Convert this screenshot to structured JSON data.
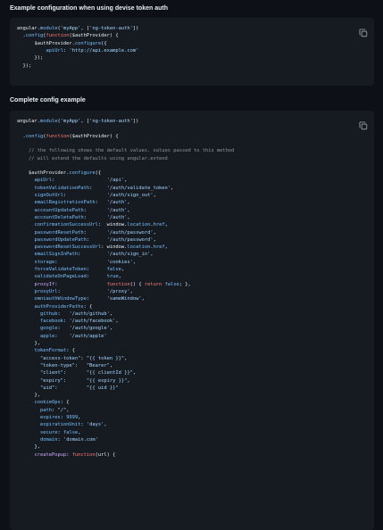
{
  "section1": {
    "heading": "Example configuration when using devise token auth",
    "code": [
      [
        {
          "t": "angular.",
          "c": "v"
        },
        {
          "t": "module",
          "c": "p"
        },
        {
          "t": "(",
          "c": "v"
        },
        {
          "t": "'myApp'",
          "c": "s"
        },
        {
          "t": ", [",
          "c": "v"
        },
        {
          "t": "'ng-token-auth'",
          "c": "s"
        },
        {
          "t": "])",
          "c": "v"
        }
      ],
      [
        {
          "t": "  .",
          "c": "v"
        },
        {
          "t": "config",
          "c": "p"
        },
        {
          "t": "(",
          "c": "v"
        },
        {
          "t": "function",
          "c": "k"
        },
        {
          "t": "($authProvider) {",
          "c": "v"
        }
      ],
      [
        {
          "t": "      $authProvider.",
          "c": "v"
        },
        {
          "t": "configure",
          "c": "p"
        },
        {
          "t": "({",
          "c": "v"
        }
      ],
      [
        {
          "t": "          ",
          "c": "v"
        },
        {
          "t": "apiUrl",
          "c": "p"
        },
        {
          "t": ": ",
          "c": "v"
        },
        {
          "t": "'http://api.example.com'",
          "c": "s"
        }
      ],
      [
        {
          "t": "      });",
          "c": "v"
        }
      ],
      [
        {
          "t": "  });",
          "c": "v"
        }
      ]
    ]
  },
  "section2": {
    "heading": "Complete config example",
    "code": [
      [
        {
          "t": "angular.",
          "c": "v"
        },
        {
          "t": "module",
          "c": "p"
        },
        {
          "t": "(",
          "c": "v"
        },
        {
          "t": "'myApp'",
          "c": "s"
        },
        {
          "t": ", [",
          "c": "v"
        },
        {
          "t": "'ng-token-auth'",
          "c": "s"
        },
        {
          "t": "])",
          "c": "v"
        }
      ],
      [],
      [
        {
          "t": "  .",
          "c": "v"
        },
        {
          "t": "config",
          "c": "p"
        },
        {
          "t": "(",
          "c": "v"
        },
        {
          "t": "function",
          "c": "k"
        },
        {
          "t": "($authProvider) {",
          "c": "v"
        }
      ],
      [],
      [
        {
          "t": "    // the following shows the default values. values passed to this method",
          "c": "c"
        }
      ],
      [
        {
          "t": "    // will extend the defaults using angular.extend",
          "c": "c"
        }
      ],
      [],
      [
        {
          "t": "    $authProvider.",
          "c": "v"
        },
        {
          "t": "configure",
          "c": "p"
        },
        {
          "t": "({",
          "c": "v"
        }
      ],
      [
        {
          "t": "      ",
          "c": "v"
        },
        {
          "t": "apiUrl",
          "c": "p"
        },
        {
          "t": ":                  ",
          "c": "v"
        },
        {
          "t": "'/api'",
          "c": "s"
        },
        {
          "t": ",",
          "c": "v"
        }
      ],
      [
        {
          "t": "      ",
          "c": "v"
        },
        {
          "t": "tokenValidationPath",
          "c": "p"
        },
        {
          "t": ":     ",
          "c": "v"
        },
        {
          "t": "'/auth/validate_token'",
          "c": "s"
        },
        {
          "t": ",",
          "c": "v"
        }
      ],
      [
        {
          "t": "      ",
          "c": "v"
        },
        {
          "t": "signOutUrl",
          "c": "p"
        },
        {
          "t": ":              ",
          "c": "v"
        },
        {
          "t": "'/auth/sign_out'",
          "c": "s"
        },
        {
          "t": ",",
          "c": "v"
        }
      ],
      [
        {
          "t": "      ",
          "c": "v"
        },
        {
          "t": "emailRegistrationPath",
          "c": "p"
        },
        {
          "t": ":   ",
          "c": "v"
        },
        {
          "t": "'/auth'",
          "c": "s"
        },
        {
          "t": ",",
          "c": "v"
        }
      ],
      [
        {
          "t": "      ",
          "c": "v"
        },
        {
          "t": "accountUpdatePath",
          "c": "p"
        },
        {
          "t": ":       ",
          "c": "v"
        },
        {
          "t": "'/auth'",
          "c": "s"
        },
        {
          "t": ",",
          "c": "v"
        }
      ],
      [
        {
          "t": "      ",
          "c": "v"
        },
        {
          "t": "accountDeletePath",
          "c": "p"
        },
        {
          "t": ":       ",
          "c": "v"
        },
        {
          "t": "'/auth'",
          "c": "s"
        },
        {
          "t": ",",
          "c": "v"
        }
      ],
      [
        {
          "t": "      ",
          "c": "v"
        },
        {
          "t": "confirmationSuccessUrl",
          "c": "p"
        },
        {
          "t": ":  window.",
          "c": "v"
        },
        {
          "t": "location",
          "c": "p"
        },
        {
          "t": ".",
          "c": "v"
        },
        {
          "t": "href",
          "c": "p"
        },
        {
          "t": ",",
          "c": "v"
        }
      ],
      [
        {
          "t": "      ",
          "c": "v"
        },
        {
          "t": "passwordResetPath",
          "c": "p"
        },
        {
          "t": ":       ",
          "c": "v"
        },
        {
          "t": "'/auth/password'",
          "c": "s"
        },
        {
          "t": ",",
          "c": "v"
        }
      ],
      [
        {
          "t": "      ",
          "c": "v"
        },
        {
          "t": "passwordUpdatePath",
          "c": "p"
        },
        {
          "t": ":      ",
          "c": "v"
        },
        {
          "t": "'/auth/password'",
          "c": "s"
        },
        {
          "t": ",",
          "c": "v"
        }
      ],
      [
        {
          "t": "      ",
          "c": "v"
        },
        {
          "t": "passwordResetSuccessUrl",
          "c": "p"
        },
        {
          "t": ": window.",
          "c": "v"
        },
        {
          "t": "location",
          "c": "p"
        },
        {
          "t": ".",
          "c": "v"
        },
        {
          "t": "href",
          "c": "p"
        },
        {
          "t": ",",
          "c": "v"
        }
      ],
      [
        {
          "t": "      ",
          "c": "v"
        },
        {
          "t": "emailSignInPath",
          "c": "p"
        },
        {
          "t": ":         ",
          "c": "v"
        },
        {
          "t": "'/auth/sign_in'",
          "c": "s"
        },
        {
          "t": ",",
          "c": "v"
        }
      ],
      [
        {
          "t": "      ",
          "c": "v"
        },
        {
          "t": "storage",
          "c": "p"
        },
        {
          "t": ":                 ",
          "c": "v"
        },
        {
          "t": "'cookies'",
          "c": "s"
        },
        {
          "t": ",",
          "c": "v"
        }
      ],
      [
        {
          "t": "      ",
          "c": "v"
        },
        {
          "t": "forceValidateToken",
          "c": "p"
        },
        {
          "t": ":      ",
          "c": "v"
        },
        {
          "t": "false",
          "c": "p"
        },
        {
          "t": ",",
          "c": "v"
        }
      ],
      [
        {
          "t": "      ",
          "c": "v"
        },
        {
          "t": "validateOnPageLoad",
          "c": "p"
        },
        {
          "t": ":      ",
          "c": "v"
        },
        {
          "t": "true",
          "c": "p"
        },
        {
          "t": ",",
          "c": "v"
        }
      ],
      [
        {
          "t": "      ",
          "c": "v"
        },
        {
          "t": "proxyIf",
          "c": "f"
        },
        {
          "t": ":                 ",
          "c": "v"
        },
        {
          "t": "function",
          "c": "k"
        },
        {
          "t": "() { ",
          "c": "v"
        },
        {
          "t": "return",
          "c": "k"
        },
        {
          "t": " ",
          "c": "v"
        },
        {
          "t": "false",
          "c": "p"
        },
        {
          "t": "; },",
          "c": "v"
        }
      ],
      [
        {
          "t": "      ",
          "c": "v"
        },
        {
          "t": "proxyUrl",
          "c": "p"
        },
        {
          "t": ":                ",
          "c": "v"
        },
        {
          "t": "'/proxy'",
          "c": "s"
        },
        {
          "t": ",",
          "c": "v"
        }
      ],
      [
        {
          "t": "      ",
          "c": "v"
        },
        {
          "t": "omniauthWindowType",
          "c": "p"
        },
        {
          "t": ":      ",
          "c": "v"
        },
        {
          "t": "'sameWindow'",
          "c": "s"
        },
        {
          "t": ",",
          "c": "v"
        }
      ],
      [
        {
          "t": "      ",
          "c": "v"
        },
        {
          "t": "authProviderPaths",
          "c": "p"
        },
        {
          "t": ": {",
          "c": "v"
        }
      ],
      [
        {
          "t": "        ",
          "c": "v"
        },
        {
          "t": "github",
          "c": "p"
        },
        {
          "t": ":   ",
          "c": "v"
        },
        {
          "t": "'/auth/github'",
          "c": "s"
        },
        {
          "t": ",",
          "c": "v"
        }
      ],
      [
        {
          "t": "        ",
          "c": "v"
        },
        {
          "t": "facebook",
          "c": "p"
        },
        {
          "t": ": ",
          "c": "v"
        },
        {
          "t": "'/auth/facebook'",
          "c": "s"
        },
        {
          "t": ",",
          "c": "v"
        }
      ],
      [
        {
          "t": "        ",
          "c": "v"
        },
        {
          "t": "google",
          "c": "p"
        },
        {
          "t": ":   ",
          "c": "v"
        },
        {
          "t": "'/auth/google'",
          "c": "s"
        },
        {
          "t": ",",
          "c": "v"
        }
      ],
      [
        {
          "t": "        ",
          "c": "v"
        },
        {
          "t": "apple",
          "c": "p"
        },
        {
          "t": ":    ",
          "c": "v"
        },
        {
          "t": "'/auth/apple'",
          "c": "s"
        }
      ],
      [
        {
          "t": "      },",
          "c": "v"
        }
      ],
      [
        {
          "t": "      ",
          "c": "v"
        },
        {
          "t": "tokenFormat",
          "c": "p"
        },
        {
          "t": ": {",
          "c": "v"
        }
      ],
      [
        {
          "t": "        ",
          "c": "v"
        },
        {
          "t": "\"access-token\"",
          "c": "s"
        },
        {
          "t": ": ",
          "c": "v"
        },
        {
          "t": "\"{{ token }}\"",
          "c": "s"
        },
        {
          "t": ",",
          "c": "v"
        }
      ],
      [
        {
          "t": "        ",
          "c": "v"
        },
        {
          "t": "\"token-type\"",
          "c": "s"
        },
        {
          "t": ":   ",
          "c": "v"
        },
        {
          "t": "\"Bearer\"",
          "c": "s"
        },
        {
          "t": ",",
          "c": "v"
        }
      ],
      [
        {
          "t": "        ",
          "c": "v"
        },
        {
          "t": "\"client\"",
          "c": "s"
        },
        {
          "t": ":       ",
          "c": "v"
        },
        {
          "t": "\"{{ clientId }}\"",
          "c": "s"
        },
        {
          "t": ",",
          "c": "v"
        }
      ],
      [
        {
          "t": "        ",
          "c": "v"
        },
        {
          "t": "\"expiry\"",
          "c": "s"
        },
        {
          "t": ":       ",
          "c": "v"
        },
        {
          "t": "\"{{ expiry }}\"",
          "c": "s"
        },
        {
          "t": ",",
          "c": "v"
        }
      ],
      [
        {
          "t": "        ",
          "c": "v"
        },
        {
          "t": "\"uid\"",
          "c": "s"
        },
        {
          "t": ":          ",
          "c": "v"
        },
        {
          "t": "\"{{ uid }}\"",
          "c": "s"
        }
      ],
      [
        {
          "t": "      },",
          "c": "v"
        }
      ],
      [
        {
          "t": "      ",
          "c": "v"
        },
        {
          "t": "cookieOps",
          "c": "p"
        },
        {
          "t": ": {",
          "c": "v"
        }
      ],
      [
        {
          "t": "        ",
          "c": "v"
        },
        {
          "t": "path",
          "c": "p"
        },
        {
          "t": ": ",
          "c": "v"
        },
        {
          "t": "\"/\"",
          "c": "s"
        },
        {
          "t": ",",
          "c": "v"
        }
      ],
      [
        {
          "t": "        ",
          "c": "v"
        },
        {
          "t": "expires",
          "c": "p"
        },
        {
          "t": ": ",
          "c": "v"
        },
        {
          "t": "9999",
          "c": "p"
        },
        {
          "t": ",",
          "c": "v"
        }
      ],
      [
        {
          "t": "        ",
          "c": "v"
        },
        {
          "t": "expirationUnit",
          "c": "p"
        },
        {
          "t": ": ",
          "c": "v"
        },
        {
          "t": "'days'",
          "c": "s"
        },
        {
          "t": ",",
          "c": "v"
        }
      ],
      [
        {
          "t": "        ",
          "c": "v"
        },
        {
          "t": "secure",
          "c": "p"
        },
        {
          "t": ": ",
          "c": "v"
        },
        {
          "t": "false",
          "c": "p"
        },
        {
          "t": ",",
          "c": "v"
        }
      ],
      [
        {
          "t": "        ",
          "c": "v"
        },
        {
          "t": "domain",
          "c": "p"
        },
        {
          "t": ": ",
          "c": "v"
        },
        {
          "t": "'domain.com'",
          "c": "s"
        }
      ],
      [
        {
          "t": "      },",
          "c": "v"
        }
      ],
      [
        {
          "t": "      ",
          "c": "v"
        },
        {
          "t": "createPopup",
          "c": "f"
        },
        {
          "t": ": ",
          "c": "v"
        },
        {
          "t": "function",
          "c": "k"
        },
        {
          "t": "(url) {",
          "c": "v"
        }
      ]
    ]
  },
  "colors": {
    "background": "#0d1117",
    "code_background": "#161b22",
    "property": "#79c0ff",
    "string": "#a5d6ff",
    "keyword": "#ff7b72",
    "function": "#d2a8ff",
    "comment": "#8b949e"
  },
  "icons": {
    "copy": "copy-icon"
  }
}
